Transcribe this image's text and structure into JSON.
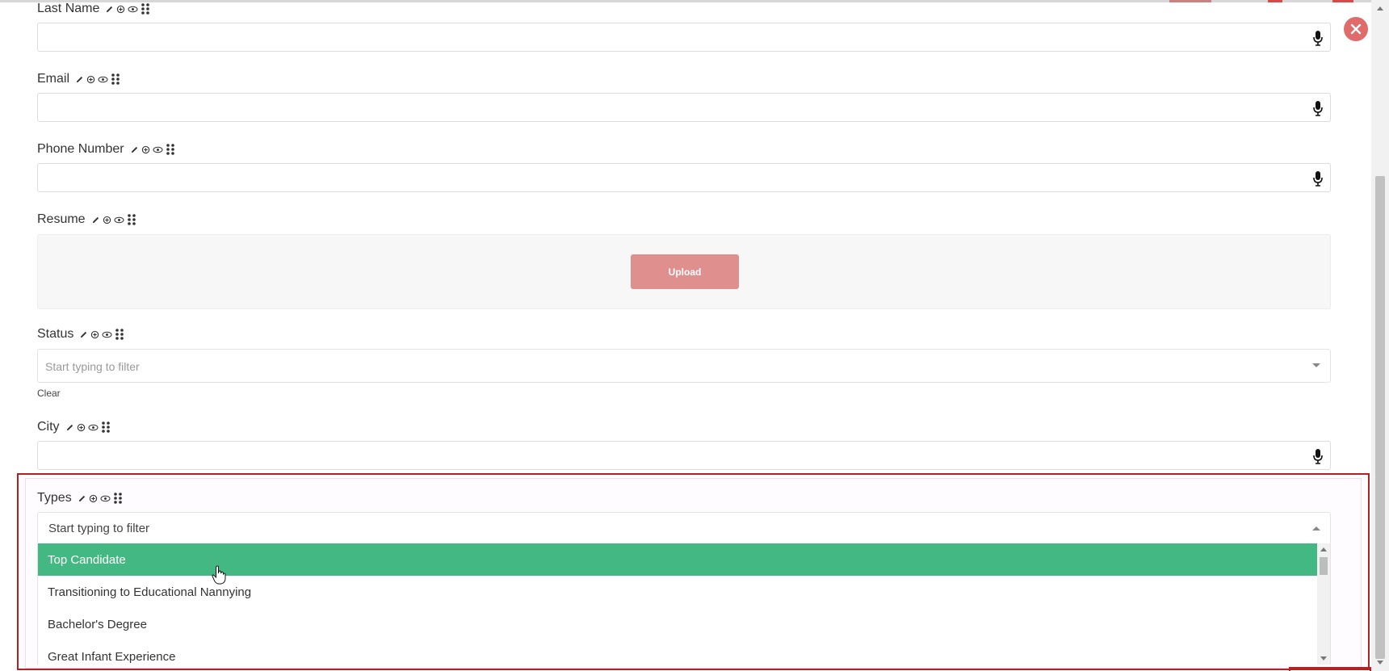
{
  "form": {
    "last_name": {
      "label": "Last Name",
      "value": ""
    },
    "email": {
      "label": "Email",
      "value": ""
    },
    "phone": {
      "label": "Phone Number",
      "value": ""
    },
    "resume": {
      "label": "Resume",
      "upload_label": "Upload"
    },
    "status": {
      "label": "Status",
      "placeholder": "Start typing to filter",
      "clear_label": "Clear"
    },
    "city": {
      "label": "City",
      "value": ""
    },
    "types": {
      "label": "Types",
      "placeholder": "Start typing to filter",
      "options": [
        "Top Candidate",
        "Transitioning to Educational Nannying",
        "Bachelor's Degree",
        "Great Infant Experience"
      ],
      "highlighted": "Top Candidate"
    }
  },
  "icons": {
    "field_tools": [
      "pencil-icon",
      "plus-circle-icon",
      "eye-icon",
      "drag-handle-icon"
    ],
    "input_action": "microphone-icon",
    "close": "close-icon"
  },
  "colors": {
    "highlight": "#43b883",
    "upload_button": "#e08f8f",
    "close_button": "#e06b6b",
    "selection_outline": "#b22222"
  }
}
